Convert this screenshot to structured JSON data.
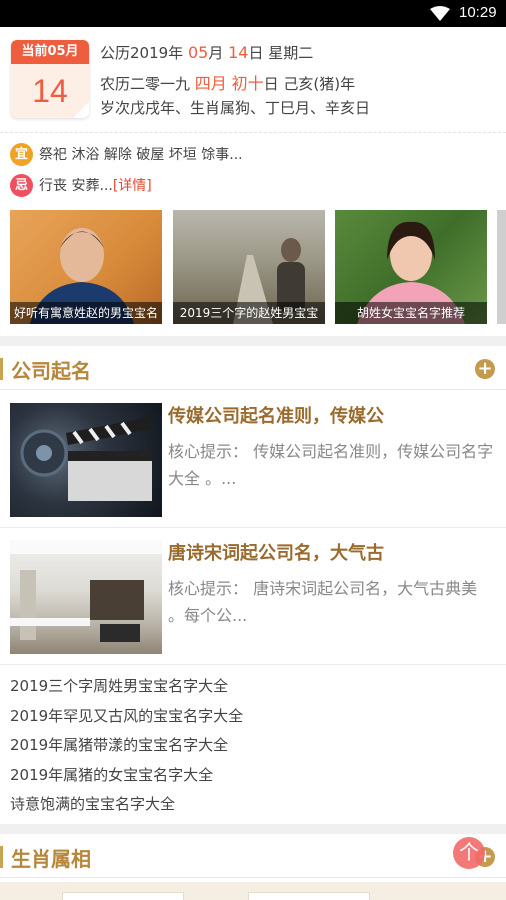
{
  "status_bar": {
    "time": "10:29",
    "wifi_icon": "wifi-icon"
  },
  "calendar": {
    "badge_label": "当前05月",
    "day": "14",
    "line1": {
      "prefix": "公历2019年 ",
      "month": "05",
      "mid": "月 ",
      "day": "14",
      "suffix": "日 星期二"
    },
    "line2": {
      "prefix": "农历二零一九 ",
      "month": "四月",
      "mid": " ",
      "day": "初十",
      "suffix": "日 己亥(猪)年"
    },
    "line3": "岁次戊戌年、生肖属狗、丁巳月、辛亥日",
    "yi_label": "宜",
    "yi_text": "祭祀 沐浴 解除 破屋 坏垣 馀事...",
    "ji_label": "忌",
    "ji_text": "行丧 安葬...",
    "detail_link": "[详情]",
    "yi_color": "#f0a224",
    "ji_color": "#ee5060"
  },
  "slides": [
    {
      "caption": "好听有寓意姓赵的男宝宝名"
    },
    {
      "caption": "2019三个字的赵姓男宝宝"
    },
    {
      "caption": "胡姓女宝宝名字推荐"
    }
  ],
  "company_section": {
    "title": "公司起名",
    "plus": "+",
    "articles": [
      {
        "title": "传媒公司起名准则，传媒公",
        "desc": "核心提示： 传媒公司起名准则，传媒公司名字大全 。..."
      },
      {
        "title": "唐诗宋词起公司名，大气古",
        "desc": "核心提示： 唐诗宋词起公司名，大气古典美 。每个公..."
      }
    ],
    "links": [
      "2019三个字周姓男宝宝名字大全",
      "2019年罕见又古风的宝宝名字大全",
      "2019年属猪带漾的宝宝名字大全",
      "2019年属猪的女宝宝名字大全",
      "诗意饱满的宝宝名字大全"
    ]
  },
  "zodiac_section": {
    "title": "生肖属相",
    "plus": "+"
  },
  "float_top": "个",
  "colors": {
    "accent": "#b6863a",
    "red": "#ee5d3e"
  }
}
